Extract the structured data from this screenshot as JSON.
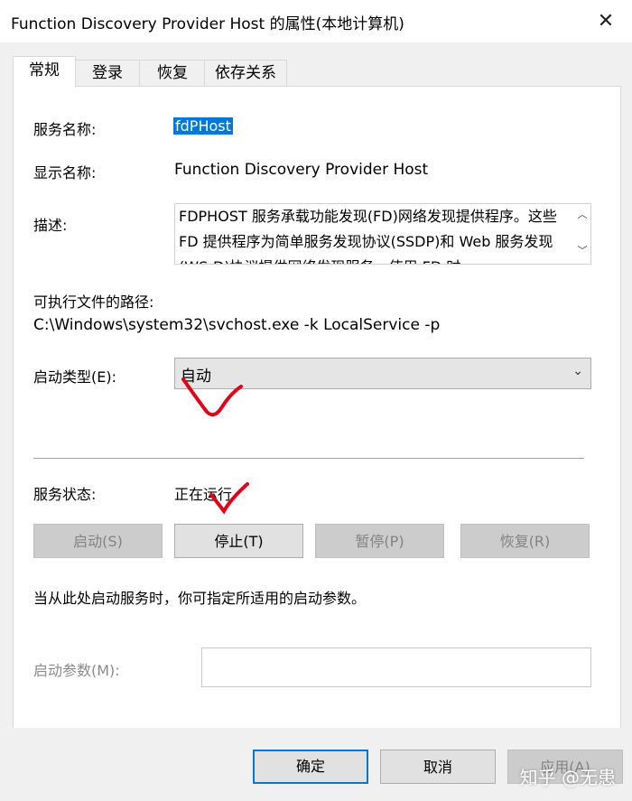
{
  "window": {
    "title": "Function Discovery Provider Host 的属性(本地计算机)"
  },
  "tabs": [
    {
      "label": "常规"
    },
    {
      "label": "登录"
    },
    {
      "label": "恢复"
    },
    {
      "label": "依存关系"
    }
  ],
  "general": {
    "service_name_label": "服务名称:",
    "service_name_value": "fdPHost",
    "display_name_label": "显示名称:",
    "display_name_value": "Function Discovery Provider Host",
    "description_label": "描述:",
    "description_value": "FDPHOST 服务承载功能发现(FD)网络发现提供程序。这些 FD 提供程序为简单服务发现协议(SSDP)和 Web 服务发现(WS-D)协议提供网络发现服务。使用 FD 时",
    "path_label": "可执行文件的路径:",
    "path_value": "C:\\Windows\\system32\\svchost.exe -k LocalService -p",
    "startup_type_label": "启动类型(E):",
    "startup_type_value": "自动",
    "service_status_label": "服务状态:",
    "service_status_value": "正在运行",
    "hint_text": "当从此处启动服务时，你可指定所适用的启动参数。",
    "start_params_label": "启动参数(M):",
    "start_params_value": ""
  },
  "service_buttons": {
    "start": "启动(S)",
    "stop": "停止(T)",
    "pause": "暂停(P)",
    "resume": "恢复(R)"
  },
  "footer_buttons": {
    "ok": "确定",
    "cancel": "取消",
    "apply": "应用(A)"
  },
  "watermark": "知乎 @无患",
  "colors": {
    "selection": "#0078d7",
    "annotation": "#e0001a"
  }
}
